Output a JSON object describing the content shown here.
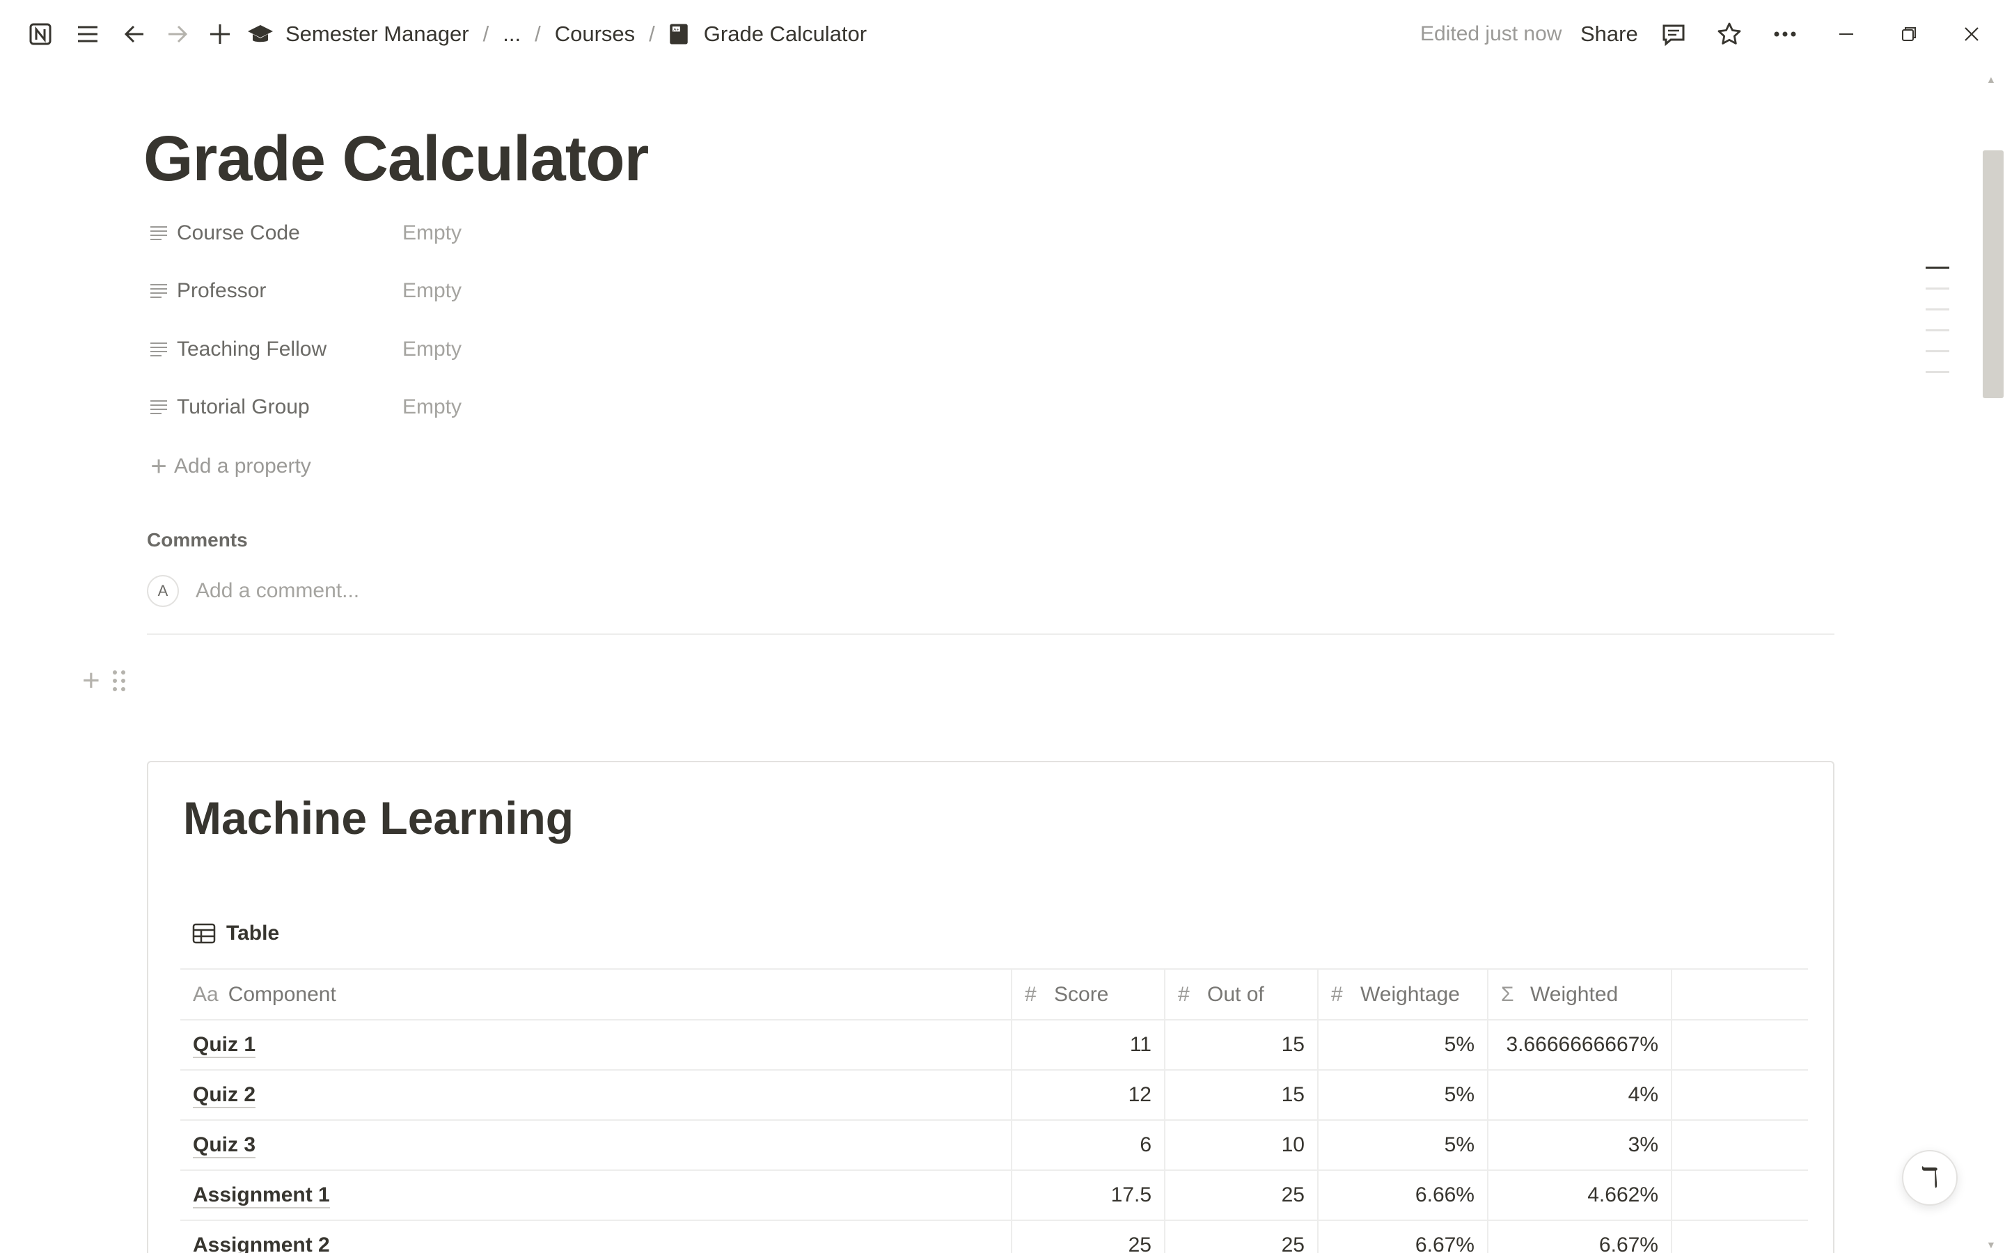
{
  "topbar": {
    "breadcrumbs": [
      "Semester Manager",
      "...",
      "Courses",
      "Grade Calculator"
    ],
    "edited_status": "Edited just now",
    "share_label": "Share"
  },
  "page": {
    "title": "Grade Calculator",
    "properties": [
      {
        "label": "Course Code",
        "value": "Empty"
      },
      {
        "label": "Professor",
        "value": "Empty"
      },
      {
        "label": "Teaching Fellow",
        "value": "Empty"
      },
      {
        "label": "Tutorial Group",
        "value": "Empty"
      }
    ],
    "add_property_label": "Add a property",
    "comments_heading": "Comments",
    "comment_avatar_initial": "A",
    "comment_placeholder": "Add a comment..."
  },
  "embed": {
    "title": "Machine Learning",
    "view_label": "Table",
    "columns": [
      {
        "icon": "Aa",
        "label": "Component"
      },
      {
        "icon": "#",
        "label": "Score"
      },
      {
        "icon": "#",
        "label": "Out of"
      },
      {
        "icon": "#",
        "label": "Weightage"
      },
      {
        "icon": "Σ",
        "label": "Weighted"
      }
    ],
    "rows": [
      {
        "component": "Quiz 1",
        "score": "11",
        "out_of": "15",
        "weightage": "5%",
        "weighted": "3.6666666667%"
      },
      {
        "component": "Quiz 2",
        "score": "12",
        "out_of": "15",
        "weightage": "5%",
        "weighted": "4%"
      },
      {
        "component": "Quiz 3",
        "score": "6",
        "out_of": "10",
        "weightage": "5%",
        "weighted": "3%"
      },
      {
        "component": "Assignment 1",
        "score": "17.5",
        "out_of": "25",
        "weightage": "6.66%",
        "weighted": "4.662%"
      },
      {
        "component": "Assignment 2",
        "score": "25",
        "out_of": "25",
        "weightage": "6.67%",
        "weighted": "6.67%"
      }
    ]
  },
  "icons": {
    "app": "notion-logo-icon",
    "menu": "hamburger-menu-icon",
    "back": "arrow-left-icon",
    "forward": "arrow-right-icon",
    "new": "plus-icon",
    "workspace": "graduation-cap-icon",
    "page": "grade-book-icon",
    "comments": "comment-icon",
    "favorite": "star-icon",
    "more": "more-horizontal-icon",
    "minimize": "minimize-icon",
    "restore": "restore-icon",
    "close": "close-icon",
    "help": "help-icon"
  },
  "colors": {
    "text": "#37352f",
    "muted": "#9b9a97",
    "border": "#e3e2e0",
    "scroll_thumb": "#d3d1cb"
  }
}
